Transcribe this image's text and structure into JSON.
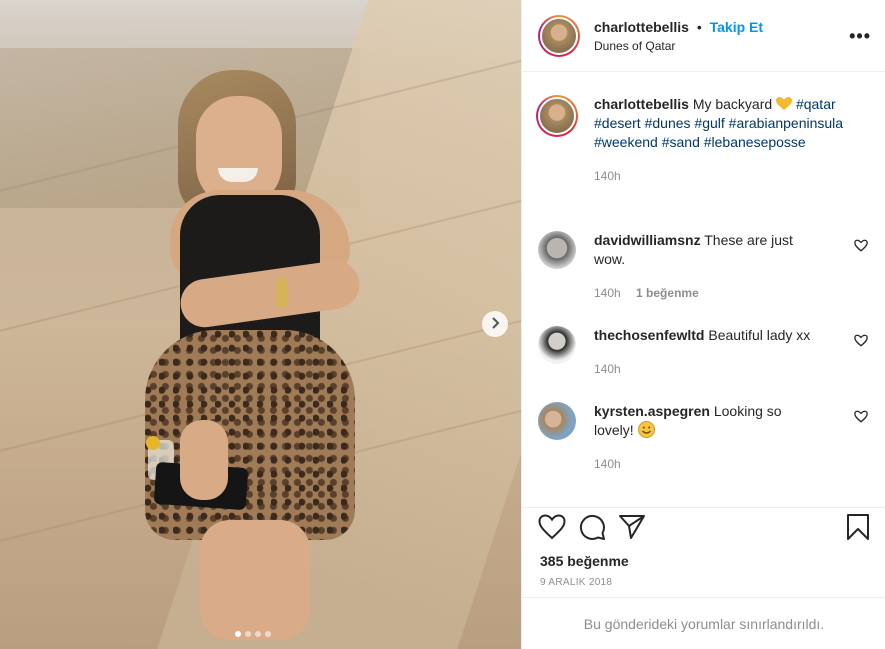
{
  "post": {
    "username": "charlottebellis",
    "separator": "•",
    "follow_label": "Takip Et",
    "location": "Dunes of Qatar",
    "more_icon": "more-horizontal-icon",
    "caption_text": "My backyard",
    "caption_tags": "#qatar #desert #dunes #gulf #arabianpeninsula #weekend #sand #lebaneseposse",
    "caption_time": "140h",
    "carousel_dots": 4,
    "carousel_active": 0
  },
  "comments": [
    {
      "username": "davidwilliamsnz",
      "text": "These are just wow.",
      "time": "140h",
      "likes": "1 beğenme"
    },
    {
      "username": "thechosenfewltd",
      "text": "Beautiful lady xx",
      "time": "140h",
      "likes": ""
    },
    {
      "username": "kyrsten.aspegren",
      "text": "Looking so lovely!",
      "time": "140h",
      "likes": ""
    }
  ],
  "actions": {
    "like_icon": "heart-icon",
    "comment_icon": "comment-icon",
    "share_icon": "send-icon",
    "save_icon": "bookmark-icon",
    "likes_count": "385 beğenme",
    "date": "9 ARALIK 2018"
  },
  "footer": {
    "notice": "Bu gönderideki yorumlar sınırlandırıldı."
  },
  "colors": {
    "link": "#0095f6",
    "hashtag": "#00376b",
    "muted": "#8e8e8e",
    "emoji_heart": "#f5b82e"
  }
}
